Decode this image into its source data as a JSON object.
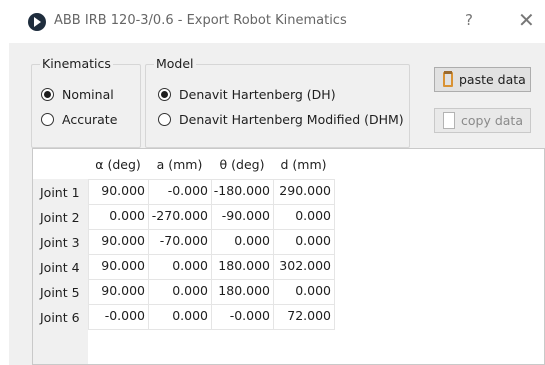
{
  "window": {
    "title": "ABB IRB 120-3/0.6 - Export Robot Kinematics",
    "help_label": "?",
    "close_label": "✕"
  },
  "kinematics": {
    "label": "Kinematics",
    "options": [
      {
        "label": "Nominal",
        "selected": true
      },
      {
        "label": "Accurate",
        "selected": false
      }
    ]
  },
  "model": {
    "label": "Model",
    "options": [
      {
        "label": "Denavit Hartenberg (DH)",
        "selected": true
      },
      {
        "label": "Denavit Hartenberg Modified (DHM)",
        "selected": false
      }
    ]
  },
  "buttons": {
    "paste_label": "paste data",
    "copy_label": "copy data"
  },
  "table": {
    "columns": [
      "α (deg)",
      "a (mm)",
      "θ (deg)",
      "d (mm)"
    ],
    "rows": [
      {
        "label": "Joint 1",
        "values": [
          "90.000",
          "-0.000",
          "-180.000",
          "290.000"
        ]
      },
      {
        "label": "Joint 2",
        "values": [
          "0.000",
          "-270.000",
          "-90.000",
          "0.000"
        ]
      },
      {
        "label": "Joint 3",
        "values": [
          "90.000",
          "-70.000",
          "0.000",
          "0.000"
        ]
      },
      {
        "label": "Joint 4",
        "values": [
          "90.000",
          "0.000",
          "180.000",
          "302.000"
        ]
      },
      {
        "label": "Joint 5",
        "values": [
          "90.000",
          "0.000",
          "180.000",
          "0.000"
        ]
      },
      {
        "label": "Joint 6",
        "values": [
          "-0.000",
          "0.000",
          "-0.000",
          "72.000"
        ]
      }
    ]
  }
}
